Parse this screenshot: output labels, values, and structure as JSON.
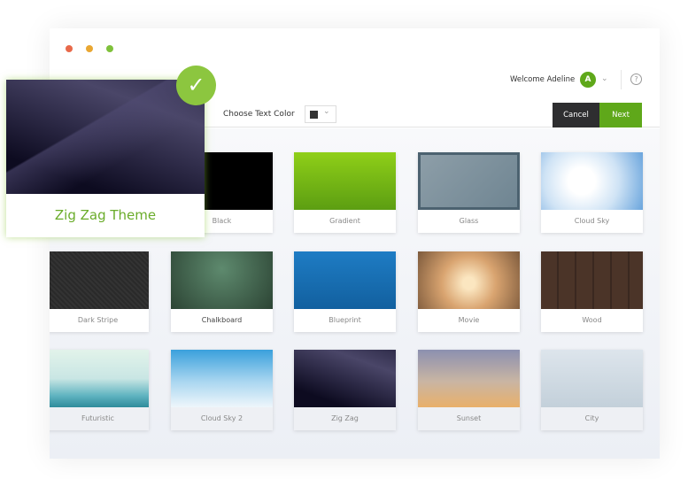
{
  "header": {
    "welcome": "Welcome Adeline",
    "avatar_initial": "A",
    "help": "?"
  },
  "toolbar": {
    "text_color_label": "Choose Text Color",
    "selected_color": "#333333",
    "cancel": "Cancel",
    "next": "Next"
  },
  "featured": {
    "label": "Zig Zag Theme",
    "selected": true
  },
  "themes": [
    {
      "label": "Black"
    },
    {
      "label": "Gradient"
    },
    {
      "label": "Glass"
    },
    {
      "label": "Cloud Sky"
    },
    {
      "label": "Dark Stripe"
    },
    {
      "label": "Chalkboard"
    },
    {
      "label": "Blueprint"
    },
    {
      "label": "Movie"
    },
    {
      "label": "Wood"
    },
    {
      "label": "Futuristic"
    },
    {
      "label": "Cloud Sky 2"
    },
    {
      "label": "Zig Zag"
    },
    {
      "label": "Sunset"
    },
    {
      "label": "City"
    }
  ],
  "colors": {
    "accent": "#6aac2a",
    "cancel_bg": "#2e2e30",
    "next_bg": "#5fa81a"
  }
}
